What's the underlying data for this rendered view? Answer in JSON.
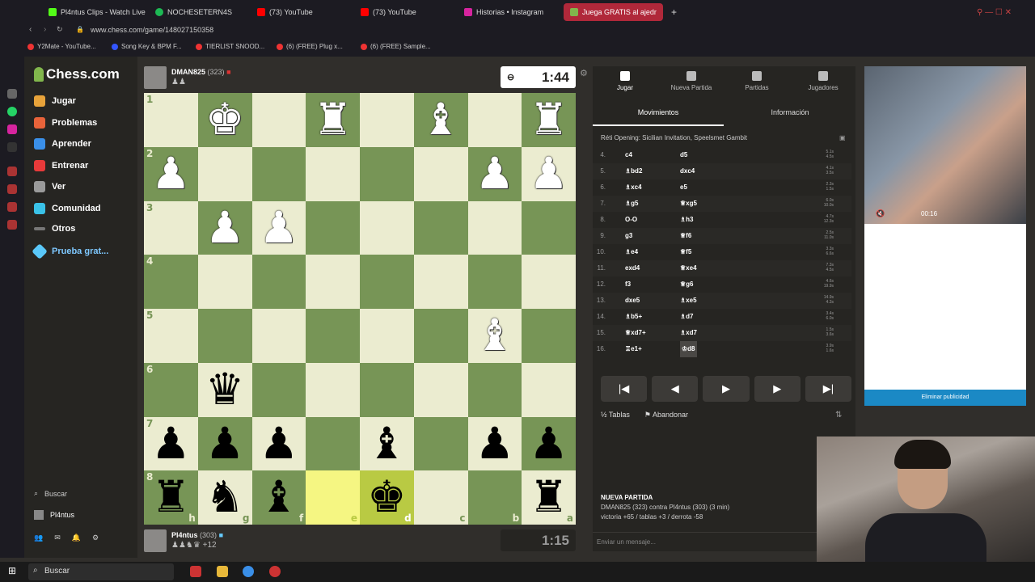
{
  "browser": {
    "tabs": [
      {
        "label": "Pl4ntus Clips - Watch Live",
        "color": "#53fc18"
      },
      {
        "label": "NOCHESETERN4S",
        "color": "#1db954"
      },
      {
        "label": "(73) YouTube",
        "color": "#ff0000"
      },
      {
        "label": "(73) YouTube",
        "color": "#ff0000"
      },
      {
        "label": "Historias • Instagram",
        "color": "#d6249f"
      },
      {
        "label": "Juega GRATIS al ajedr",
        "color": "#81b64c"
      }
    ],
    "url": "www.chess.com/game/148027150358",
    "bookmarks": [
      "Y2Mate - YouTube...",
      "Song Key & BPM F...",
      "TIERLIST SNOOD...",
      "(6) (FREE) Plug x...",
      "(6) (FREE) Sample..."
    ]
  },
  "nav": {
    "logo": "Chess.com",
    "items": [
      "Jugar",
      "Problemas",
      "Aprender",
      "Entrenar",
      "Ver",
      "Comunidad",
      "Otros",
      "Prueba grat..."
    ],
    "search": "Buscar",
    "user": "Pl4ntus"
  },
  "top_player": {
    "name": "DMAN825",
    "rating": "(323)",
    "clock": "1:44"
  },
  "bottom_player": {
    "name": "Pl4ntus",
    "rating": "(303)",
    "captures": "+12",
    "clock": "1:15"
  },
  "board": {
    "ranks": [
      "1",
      "2",
      "3",
      "4",
      "5",
      "6",
      "7",
      "8"
    ],
    "files": [
      "h",
      "g",
      "f",
      "e",
      "d",
      "c",
      "b",
      "a"
    ],
    "rows": [
      [
        "",
        "wK",
        "",
        "wR",
        "",
        "wB",
        "",
        "wR"
      ],
      [
        "wP",
        "",
        "",
        "",
        "",
        "",
        "wP",
        "wP"
      ],
      [
        "",
        "wP",
        "wP",
        "",
        "",
        "",
        "",
        ""
      ],
      [
        "",
        "",
        "",
        "",
        "",
        "",
        "",
        ""
      ],
      [
        "",
        "",
        "",
        "",
        "",
        "",
        "wB",
        ""
      ],
      [
        "",
        "bQ",
        "",
        "",
        "",
        "",
        "",
        ""
      ],
      [
        "bP",
        "bP",
        "bP",
        "",
        "bB",
        "",
        "bP",
        "bP"
      ],
      [
        "bR",
        "bN",
        "bB",
        "",
        "bK",
        "",
        "",
        "bR"
      ]
    ],
    "highlights": {
      "7-3": "hl",
      "7-4": "hl2"
    }
  },
  "panel": {
    "tabs": [
      "Jugar",
      "Nueva Partida",
      "Partidas",
      "Jugadores"
    ],
    "subtabs": [
      "Movimientos",
      "Información"
    ],
    "opening": "Réti Opening: Sicilian Invitation, Speelsmet Gambit",
    "moves": [
      {
        "n": "4.",
        "w": "c4",
        "b": "d5",
        "t": "5.1s 4.5s"
      },
      {
        "n": "5.",
        "w": "♗bd2",
        "b": "dxc4",
        "t": "4.1s 3.5s"
      },
      {
        "n": "6.",
        "w": "♗xc4",
        "b": "e5",
        "t": "2.3s 1.5s"
      },
      {
        "n": "7.",
        "w": "♗g5",
        "b": "♕xg5",
        "t": "6.0s 10.0s"
      },
      {
        "n": "8.",
        "w": "O-O",
        "b": "♗h3",
        "t": "4.7s 12.3s"
      },
      {
        "n": "9.",
        "w": "g3",
        "b": "♕f6",
        "t": "2.5s 11.0s"
      },
      {
        "n": "10.",
        "w": "♗e4",
        "b": "♕f5",
        "t": "3.3s 6.6s"
      },
      {
        "n": "11.",
        "w": "exd4",
        "b": "♕xe4",
        "t": "7.3s 4.5s"
      },
      {
        "n": "12.",
        "w": "f3",
        "b": "♕g6",
        "t": "4.6s 19.9s"
      },
      {
        "n": "13.",
        "w": "dxe5",
        "b": "♗xe5",
        "t": "14.9s 4.3s"
      },
      {
        "n": "14.",
        "w": "♗b5+",
        "b": "♗d7",
        "t": "3.4s 6.0s"
      },
      {
        "n": "15.",
        "w": "♕xd7+",
        "b": "♗xd7",
        "t": "1.5s 3.6s"
      },
      {
        "n": "16.",
        "w": "♖e1+",
        "b": "♔d8",
        "t": "3.9s 1.6s"
      }
    ],
    "controls": [
      "|◀",
      "◀",
      "▶",
      "▶",
      "▶|"
    ],
    "draw": "Tablas",
    "resign": "Abandonar",
    "game_title": "NUEVA PARTIDA",
    "game_line": "DMAN825 (323) contra Pl4ntus (303) (3 min)",
    "game_stats": "victoria +65 / tablas +3 / derrota -58",
    "chat_placeholder": "Enviar un mensaje..."
  },
  "ad": {
    "time": "00:16",
    "remove": "Eliminar publicidad"
  },
  "taskbar": {
    "search": "Buscar"
  }
}
